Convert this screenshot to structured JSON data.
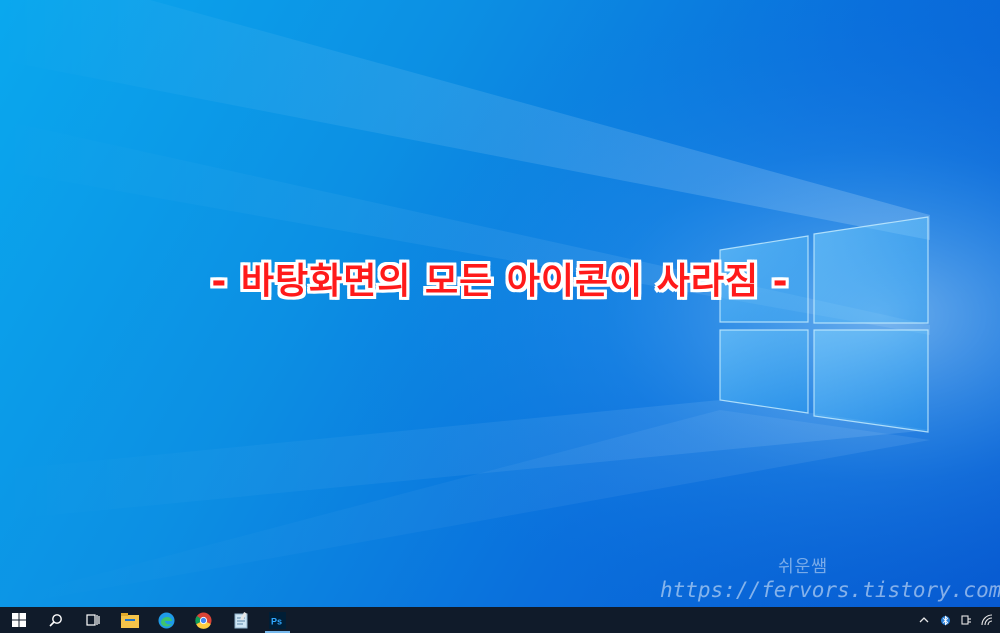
{
  "overlay": {
    "caption": "- 바탕화면의 모든 아이콘이 사라짐 -"
  },
  "watermark": {
    "name": "쉬운쌤",
    "url": "https://fervors.tistory.com"
  },
  "taskbar": {
    "apps": [
      {
        "name": "start",
        "icon": "windows-logo-icon"
      },
      {
        "name": "search",
        "icon": "search-icon"
      },
      {
        "name": "task-view",
        "icon": "task-view-icon"
      },
      {
        "name": "file-explorer",
        "icon": "folder-icon"
      },
      {
        "name": "edge",
        "icon": "edge-icon"
      },
      {
        "name": "chrome",
        "icon": "chrome-icon"
      },
      {
        "name": "notepad",
        "icon": "notepad-icon"
      },
      {
        "name": "photoshop",
        "icon": "photoshop-icon",
        "label": "Ps"
      }
    ],
    "tray": [
      "chevron-up-icon",
      "bluetooth-icon",
      "power-plug-icon",
      "wifi-icon"
    ]
  },
  "colors": {
    "caption_red": "#ff1a1a",
    "taskbar_bg": "#101b2a",
    "desktop_blue": "#0a8fe3"
  }
}
